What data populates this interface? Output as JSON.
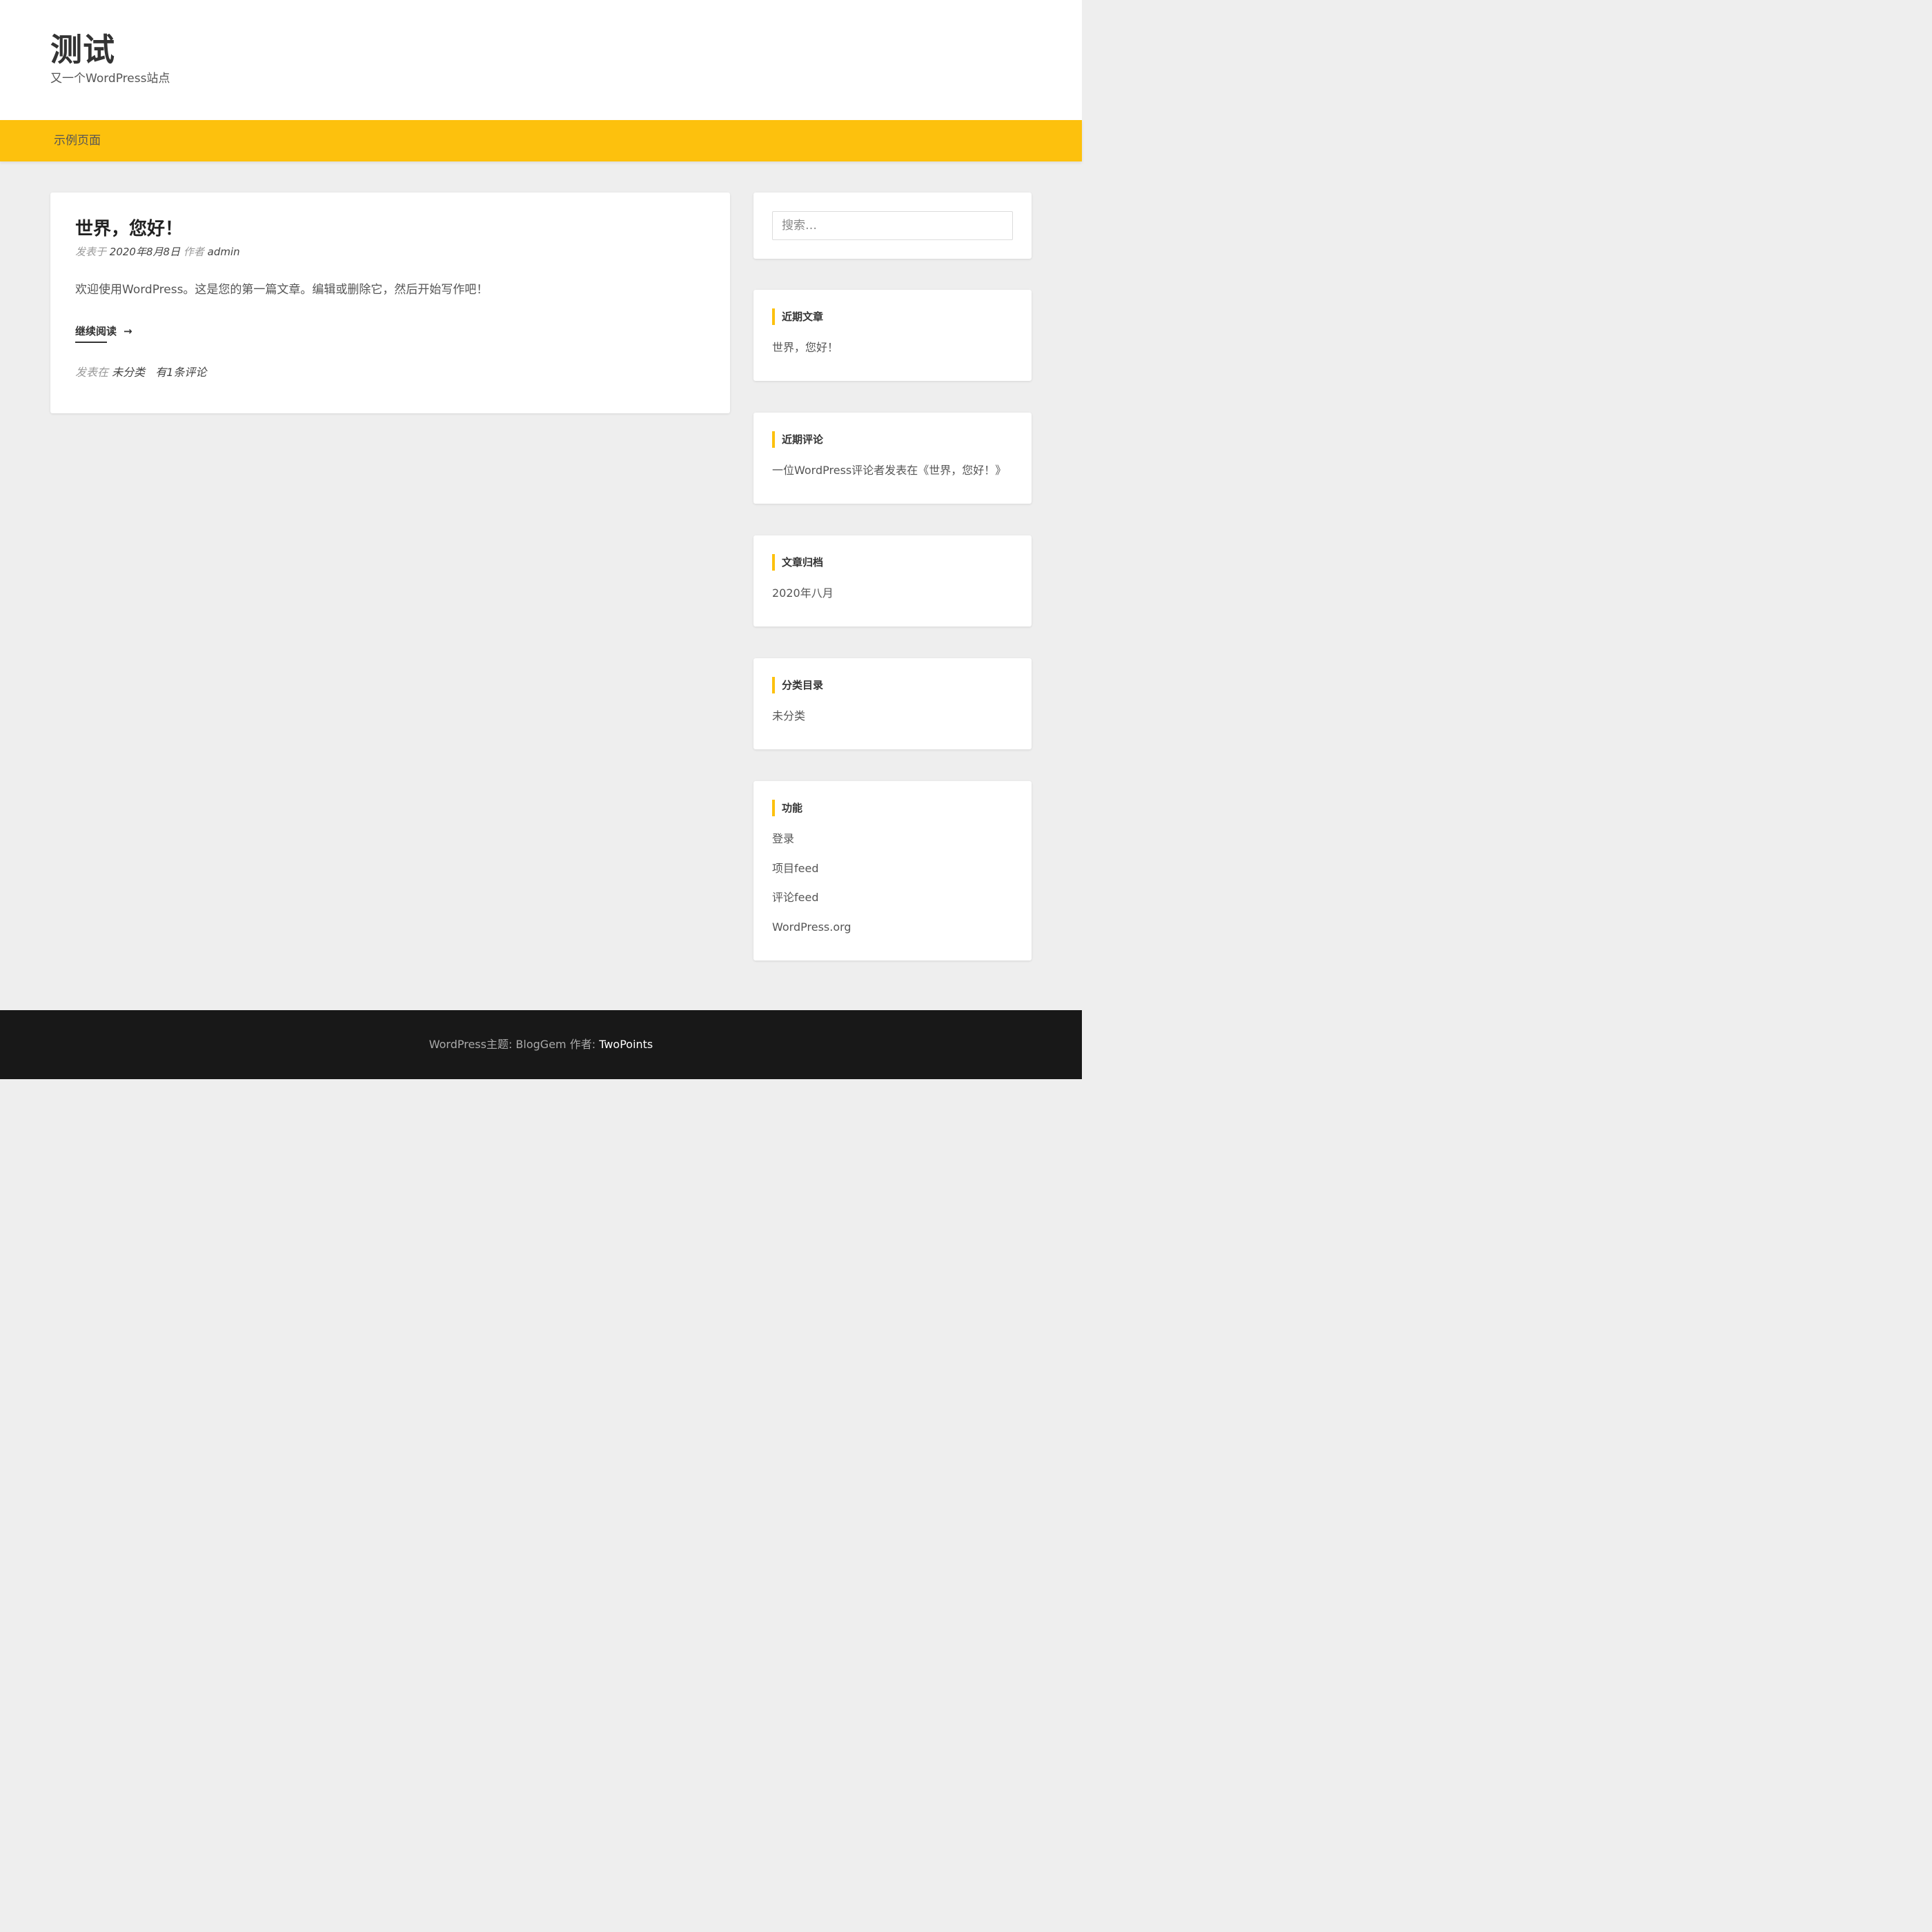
{
  "header": {
    "site_title": "测试",
    "site_description": "又一个WordPress站点"
  },
  "nav": {
    "items": [
      {
        "label": "示例页面"
      }
    ]
  },
  "post": {
    "title": "世界，您好！",
    "meta": {
      "posted_on_label": "发表于",
      "date": "2020年8月8日",
      "author_label": "作者",
      "author": "admin"
    },
    "excerpt": "欢迎使用WordPress。这是您的第一篇文章。编辑或删除它，然后开始写作吧！",
    "read_more": "继续阅读",
    "footer": {
      "posted_in_label": "发表在",
      "category": "未分类",
      "comments": "有1条评论"
    }
  },
  "sidebar": {
    "search": {
      "placeholder": "搜索…"
    },
    "recent_posts": {
      "title": "近期文章",
      "items": [
        "世界，您好！"
      ]
    },
    "recent_comments": {
      "title": "近期评论",
      "items": [
        "一位WordPress评论者发表在《世界，您好！》"
      ]
    },
    "archives": {
      "title": "文章归档",
      "items": [
        "2020年八月"
      ]
    },
    "categories": {
      "title": "分类目录",
      "items": [
        "未分类"
      ]
    },
    "meta": {
      "title": "功能",
      "items": [
        "登录",
        "项目feed",
        "评论feed",
        "WordPress.org"
      ]
    }
  },
  "footer": {
    "theme_label": "WordPress主题: BlogGem 作者: ",
    "theme_author": "TwoPoints"
  },
  "colors": {
    "accent": "#fdc10d",
    "background": "#eeeeee",
    "footer_bg": "#181818"
  }
}
